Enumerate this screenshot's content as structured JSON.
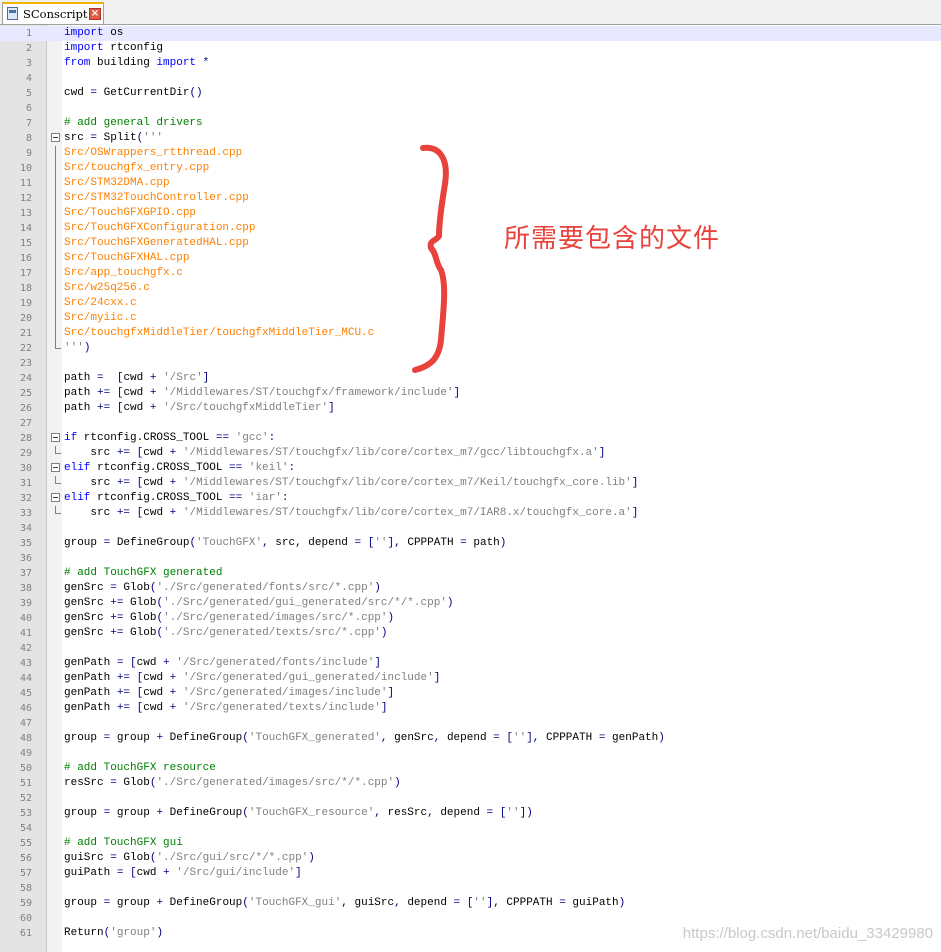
{
  "tab": {
    "filename": "SConscript",
    "close_icon": "close-icon"
  },
  "annotation": {
    "text": "所需要包含的文件",
    "color": "#e8423c"
  },
  "watermark": "https://blog.csdn.net/baidu_33429980",
  "lines": [
    {
      "n": "1",
      "t": "import os"
    },
    {
      "n": "2",
      "t": "import rtconfig"
    },
    {
      "n": "3",
      "t": "from building import *"
    },
    {
      "n": "4",
      "t": ""
    },
    {
      "n": "5",
      "t": "cwd = GetCurrentDir()"
    },
    {
      "n": "6",
      "t": ""
    },
    {
      "n": "7",
      "t": "# add general drivers"
    },
    {
      "n": "8",
      "t": "src = Split('''"
    },
    {
      "n": "9",
      "t": "Src/OSWrappers_rtthread.cpp"
    },
    {
      "n": "10",
      "t": "Src/touchgfx_entry.cpp"
    },
    {
      "n": "11",
      "t": "Src/STM32DMA.cpp"
    },
    {
      "n": "12",
      "t": "Src/STM32TouchController.cpp"
    },
    {
      "n": "13",
      "t": "Src/TouchGFXGPIO.cpp"
    },
    {
      "n": "14",
      "t": "Src/TouchGFXConfiguration.cpp"
    },
    {
      "n": "15",
      "t": "Src/TouchGFXGeneratedHAL.cpp"
    },
    {
      "n": "16",
      "t": "Src/TouchGFXHAL.cpp"
    },
    {
      "n": "17",
      "t": "Src/app_touchgfx.c"
    },
    {
      "n": "18",
      "t": "Src/w25q256.c"
    },
    {
      "n": "19",
      "t": "Src/24cxx.c"
    },
    {
      "n": "20",
      "t": "Src/myiic.c"
    },
    {
      "n": "21",
      "t": "Src/touchgfxMiddleTier/touchgfxMiddleTier_MCU.c"
    },
    {
      "n": "22",
      "t": "''')"
    },
    {
      "n": "23",
      "t": ""
    },
    {
      "n": "24",
      "t": "path =  [cwd + '/Src']"
    },
    {
      "n": "25",
      "t": "path += [cwd + '/Middlewares/ST/touchgfx/framework/include']"
    },
    {
      "n": "26",
      "t": "path += [cwd + '/Src/touchgfxMiddleTier']"
    },
    {
      "n": "27",
      "t": ""
    },
    {
      "n": "28",
      "t": "if rtconfig.CROSS_TOOL == 'gcc':"
    },
    {
      "n": "29",
      "t": "    src += [cwd + '/Middlewares/ST/touchgfx/lib/core/cortex_m7/gcc/libtouchgfx.a']"
    },
    {
      "n": "30",
      "t": "elif rtconfig.CROSS_TOOL == 'keil':"
    },
    {
      "n": "31",
      "t": "    src += [cwd + '/Middlewares/ST/touchgfx/lib/core/cortex_m7/Keil/touchgfx_core.lib']"
    },
    {
      "n": "32",
      "t": "elif rtconfig.CROSS_TOOL == 'iar':"
    },
    {
      "n": "33",
      "t": "    src += [cwd + '/Middlewares/ST/touchgfx/lib/core/cortex_m7/IAR8.x/touchgfx_core.a']"
    },
    {
      "n": "34",
      "t": ""
    },
    {
      "n": "35",
      "t": "group = DefineGroup('TouchGFX', src, depend = [''], CPPPATH = path)"
    },
    {
      "n": "36",
      "t": ""
    },
    {
      "n": "37",
      "t": "# add TouchGFX generated"
    },
    {
      "n": "38",
      "t": "genSrc = Glob('./Src/generated/fonts/src/*.cpp')"
    },
    {
      "n": "39",
      "t": "genSrc += Glob('./Src/generated/gui_generated/src/*/*.cpp')"
    },
    {
      "n": "40",
      "t": "genSrc += Glob('./Src/generated/images/src/*.cpp')"
    },
    {
      "n": "41",
      "t": "genSrc += Glob('./Src/generated/texts/src/*.cpp')"
    },
    {
      "n": "42",
      "t": ""
    },
    {
      "n": "43",
      "t": "genPath = [cwd + '/Src/generated/fonts/include']"
    },
    {
      "n": "44",
      "t": "genPath += [cwd + '/Src/generated/gui_generated/include']"
    },
    {
      "n": "45",
      "t": "genPath += [cwd + '/Src/generated/images/include']"
    },
    {
      "n": "46",
      "t": "genPath += [cwd + '/Src/generated/texts/include']"
    },
    {
      "n": "47",
      "t": ""
    },
    {
      "n": "48",
      "t": "group = group + DefineGroup('TouchGFX_generated', genSrc, depend = [''], CPPPATH = genPath)"
    },
    {
      "n": "49",
      "t": ""
    },
    {
      "n": "50",
      "t": "# add TouchGFX resource"
    },
    {
      "n": "51",
      "t": "resSrc = Glob('./Src/generated/images/src/*/*.cpp')"
    },
    {
      "n": "52",
      "t": ""
    },
    {
      "n": "53",
      "t": "group = group + DefineGroup('TouchGFX_resource', resSrc, depend = [''])"
    },
    {
      "n": "54",
      "t": ""
    },
    {
      "n": "55",
      "t": "# add TouchGFX gui"
    },
    {
      "n": "56",
      "t": "guiSrc = Glob('./Src/gui/src/*/*.cpp')"
    },
    {
      "n": "57",
      "t": "guiPath = [cwd + '/Src/gui/include']"
    },
    {
      "n": "58",
      "t": ""
    },
    {
      "n": "59",
      "t": "group = group + DefineGroup('TouchGFX_gui', guiSrc, depend = [''], CPPPATH = guiPath)"
    },
    {
      "n": "60",
      "t": ""
    },
    {
      "n": "61",
      "t": "Return('group')"
    }
  ]
}
